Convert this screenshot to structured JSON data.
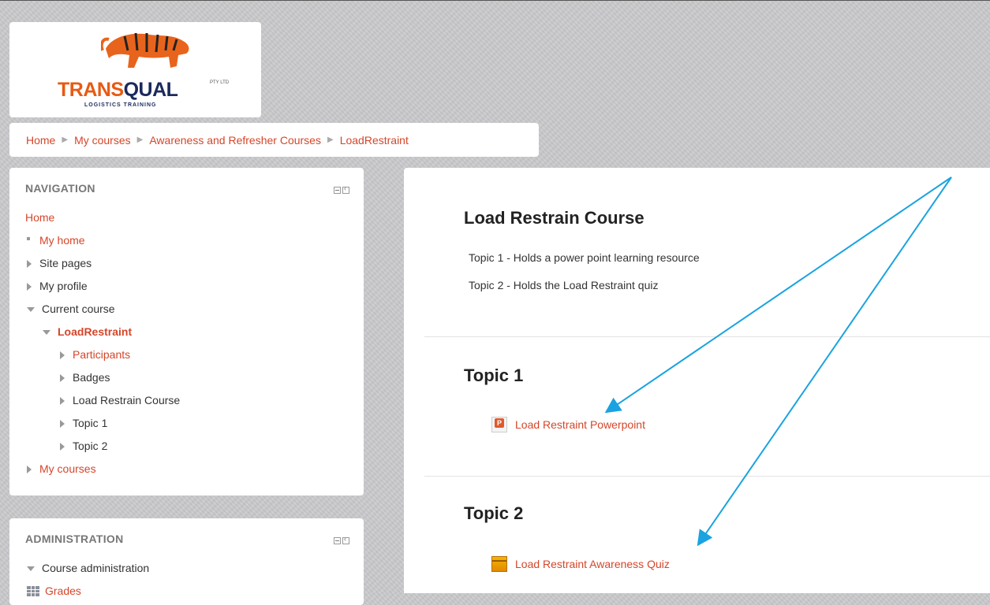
{
  "logo": {
    "name": "TRANS",
    "name_q": "QUAL",
    "tm": "PTY LTD",
    "subtitle": "LOGISTICS TRAINING"
  },
  "breadcrumb": [
    "Home",
    "My courses",
    "Awareness and Refresher Courses",
    "LoadRestraint"
  ],
  "navigation": {
    "title": "NAVIGATION",
    "items": {
      "home": "Home",
      "my_home": "My home",
      "site_pages": "Site pages",
      "my_profile": "My profile",
      "current_course": "Current course",
      "course": "LoadRestraint",
      "participants": "Participants",
      "badges": "Badges",
      "load_restrain_course": "Load Restrain Course",
      "topic1": "Topic 1",
      "topic2": "Topic 2",
      "my_courses": "My courses"
    }
  },
  "administration": {
    "title": "ADMINISTRATION",
    "course_admin": "Course administration",
    "grades": "Grades"
  },
  "main": {
    "course_title": "Load Restrain Course",
    "summary": [
      "Topic 1 - Holds a power point learning resource",
      "Topic 2 - Holds the Load Restraint quiz"
    ],
    "topic1": {
      "title": "Topic 1",
      "activity": "Load Restraint Powerpoint"
    },
    "topic2": {
      "title": "Topic 2",
      "activity": "Load Restraint Awareness Quiz"
    }
  },
  "colors": {
    "link": "#d4462a",
    "annotation_arrow": "#1aa3e0"
  },
  "icons": {
    "powerpoint": "powerpoint-file-icon",
    "quiz": "quiz-icon",
    "grades": "grades-icon"
  }
}
